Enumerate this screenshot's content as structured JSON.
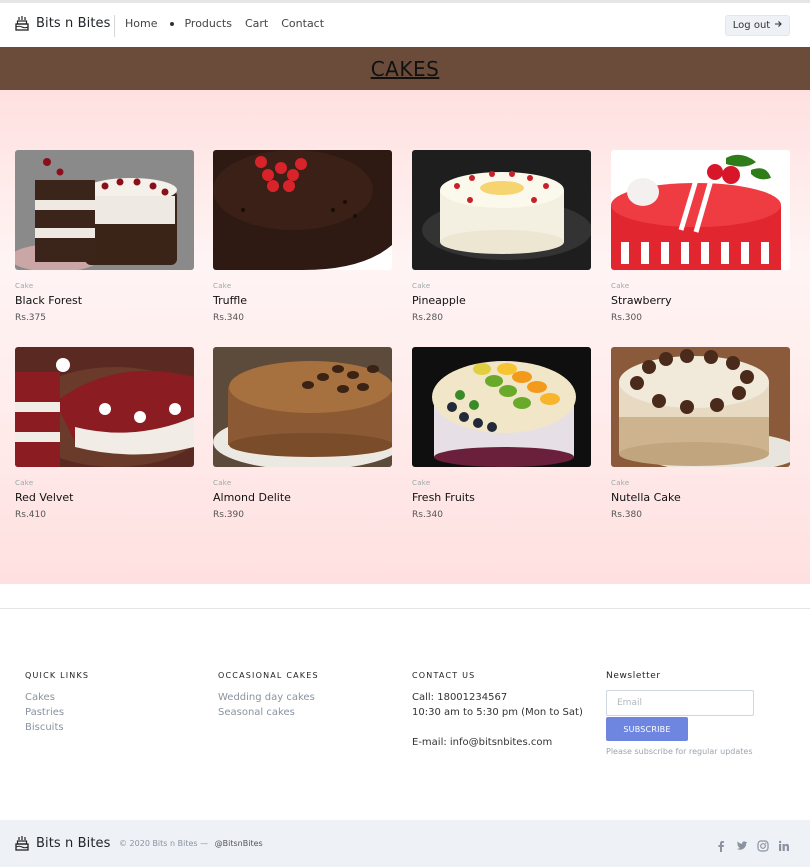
{
  "nav": {
    "brand": "Bits n Bites",
    "links": [
      "Home",
      "Products",
      "Cart",
      "Contact"
    ],
    "logout_label": "Log out",
    "logout_icon": "arrow-right-icon"
  },
  "banner": {
    "title": "CAKES"
  },
  "products": [
    {
      "category": "Cake",
      "name": "Black Forest",
      "price": "Rs.375"
    },
    {
      "category": "Cake",
      "name": "Truffle",
      "price": "Rs.340"
    },
    {
      "category": "Cake",
      "name": "Pineapple",
      "price": "Rs.280"
    },
    {
      "category": "Cake",
      "name": "Strawberry",
      "price": "Rs.300"
    },
    {
      "category": "Cake",
      "name": "Red Velvet",
      "price": "Rs.410"
    },
    {
      "category": "Cake",
      "name": "Almond Delite",
      "price": "Rs.390"
    },
    {
      "category": "Cake",
      "name": "Fresh Fruits",
      "price": "Rs.340"
    },
    {
      "category": "Cake",
      "name": "Nutella Cake",
      "price": "Rs.380"
    }
  ],
  "footer": {
    "quick_links": {
      "heading": "QUICK LINKS",
      "items": [
        "Cakes",
        "Pastries",
        "Biscuits"
      ]
    },
    "occasional": {
      "heading": "OCCASIONAL CAKES",
      "items": [
        "Wedding day cakes",
        "Seasonal cakes"
      ]
    },
    "contact": {
      "heading": "CONTACT US",
      "call": "Call: 18001234567",
      "hours": "10:30 am to 5:30 pm (Mon to Sat)",
      "email": "E-mail: info@bitsnbites.com"
    },
    "newsletter": {
      "heading": "Newsletter",
      "placeholder": "Email",
      "button": "SUBSCRIBE",
      "note": "Please subscribe for regular updates"
    }
  },
  "bottom": {
    "brand": "Bits n Bites",
    "copyright": "© 2020 Bits n Bites —",
    "handle": "@BitsnBites",
    "social_icons": [
      "facebook-icon",
      "twitter-icon",
      "instagram-icon",
      "linkedin-icon"
    ]
  },
  "colors": {
    "banner": "#6b4c3b",
    "products_bg": "#ffe6e6",
    "subscribe": "#6f86e0",
    "bottom_bar": "#eef2f7"
  }
}
